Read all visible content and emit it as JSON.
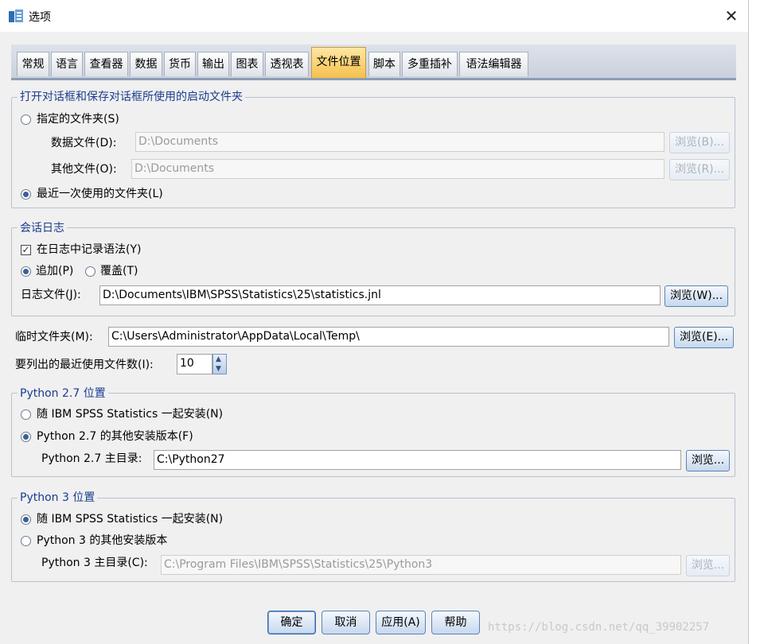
{
  "window": {
    "title": "选项",
    "close_glyph": "✕"
  },
  "tabs": [
    {
      "label": "常规"
    },
    {
      "label": "语言"
    },
    {
      "label": "查看器"
    },
    {
      "label": "数据"
    },
    {
      "label": "货币"
    },
    {
      "label": "输出"
    },
    {
      "label": "图表"
    },
    {
      "label": "透视表"
    },
    {
      "label": "文件位置",
      "active": true
    },
    {
      "label": "脚本"
    },
    {
      "label": "多重插补"
    },
    {
      "label": "语法编辑器"
    }
  ],
  "startup": {
    "legend": "打开对话框和保存对话框所使用的启动文件夹",
    "specified_label": "指定的文件夹(S)",
    "data_file_label": "数据文件(D):",
    "data_file_value": "D:\\Documents",
    "data_browse": "浏览(B)...",
    "other_file_label": "其他文件(O):",
    "other_file_value": "D:\\Documents",
    "other_browse": "浏览(R)...",
    "last_used_label": "最近一次使用的文件夹(L)"
  },
  "journal": {
    "legend": "会话日志",
    "record_label": "在日志中记录语法(Y)",
    "append_label": "追加(P)",
    "overwrite_label": "覆盖(T)",
    "file_label": "日志文件(J):",
    "file_value": "D:\\Documents\\IBM\\SPSS\\Statistics\\25\\statistics.jnl",
    "browse": "浏览(W)..."
  },
  "temp": {
    "label": "临时文件夹(M):",
    "value": "C:\\Users\\Administrator\\AppData\\Local\\Temp\\",
    "browse": "浏览(E)..."
  },
  "recent": {
    "label": "要列出的最近使用文件数(I):",
    "value": "10"
  },
  "python27": {
    "legend": "Python 2.7 位置",
    "bundled_label": "随 IBM SPSS Statistics 一起安装(N)",
    "other_label": "Python 2.7 的其他安装版本(F)",
    "home_label": "Python 2.7 主目录:",
    "home_value": "C:\\Python27",
    "browse": "浏览..."
  },
  "python3": {
    "legend": "Python 3 位置",
    "bundled_label": "随 IBM SPSS Statistics 一起安装(N)",
    "other_label": "Python 3 的其他安装版本",
    "home_label": "Python 3 主目录(C):",
    "home_value": "C:\\Program Files\\IBM\\SPSS\\Statistics\\25\\Python3",
    "browse": "浏览..."
  },
  "buttons": {
    "ok": "确定",
    "cancel": "取消",
    "apply": "应用(A)",
    "help": "帮助"
  },
  "watermark": "https://blog.csdn.net/qq_39902257",
  "colors": {
    "legend": "#1a3c8f",
    "active_tab": "#f6c04e",
    "button_border": "#5b83b8"
  }
}
